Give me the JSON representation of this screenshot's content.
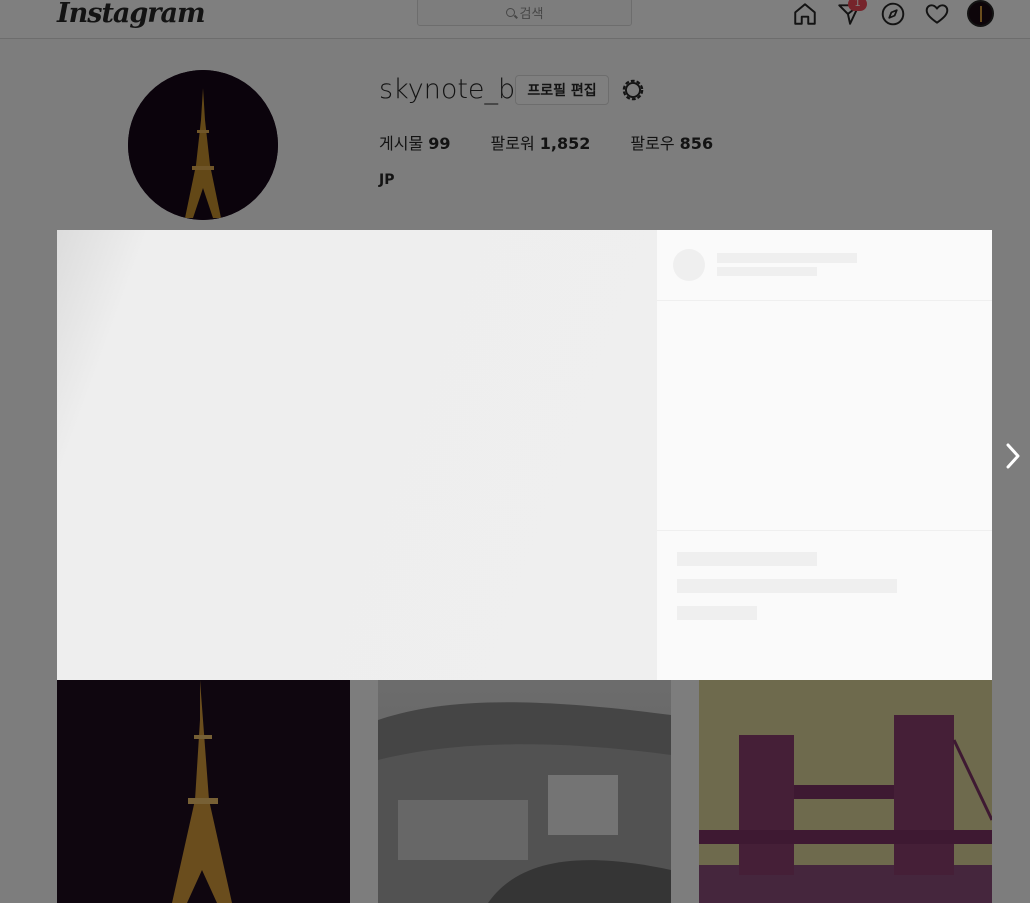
{
  "header": {
    "logo": "Instagram",
    "search_placeholder": "검색",
    "notification_count": "1",
    "icons": [
      "home-icon",
      "direct-icon",
      "explore-icon",
      "activity-heart-icon",
      "profile-avatar-icon"
    ]
  },
  "profile": {
    "username": "skynote_b",
    "edit_button": "프로필 편집",
    "stats": {
      "posts_label": "게시물",
      "posts_value": "99",
      "followers_label": "팔로워",
      "followers_value": "1,852",
      "following_label": "팔로우",
      "following_value": "856"
    },
    "bio": "JP"
  },
  "colors": {
    "accent": "#ed4956",
    "border": "#dbdbdb",
    "background": "#fafafa"
  }
}
